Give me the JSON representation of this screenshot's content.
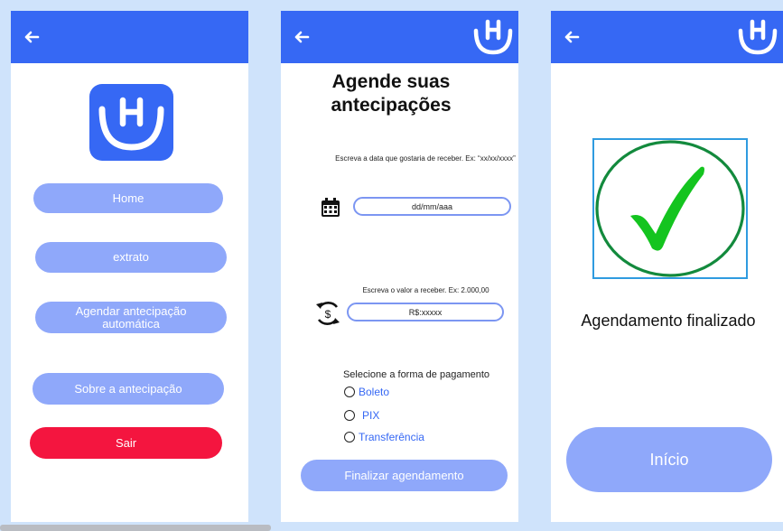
{
  "screen_home": {
    "menu": {
      "home": "Home",
      "extrato": "extrato",
      "agendar": "Agendar antecipação automática",
      "sobre": "Sobre a antecipação",
      "sair": "Sair"
    }
  },
  "screen_agendar": {
    "title": "Agende suas antecipações",
    "date_hint": "Escreva a data que gostaria de receber. Ex: “xx/xx/xxxx”",
    "date_placeholder": "dd/mm/aaa",
    "value_hint": "Escreva o valor a receber. Ex: 2.000,00",
    "value_placeholder": "R$:xxxxx",
    "payment_label": "Selecione a forma de pagamento",
    "payment_options": [
      "Boleto",
      "PIX",
      "Transferência"
    ],
    "submit": "Finalizar agendamento"
  },
  "screen_done": {
    "message": "Agendamento finalizado",
    "start": "Início"
  },
  "colors": {
    "brand_blue": "#3668f4",
    "light_button": "#8fa8fa",
    "danger": "#f4153f",
    "check_green": "#14c41f",
    "circle_green": "#138a3d"
  },
  "icons": [
    "back-arrow-icon",
    "brand-logo-icon",
    "calendar-icon",
    "currency-exchange-icon",
    "check-icon"
  ]
}
